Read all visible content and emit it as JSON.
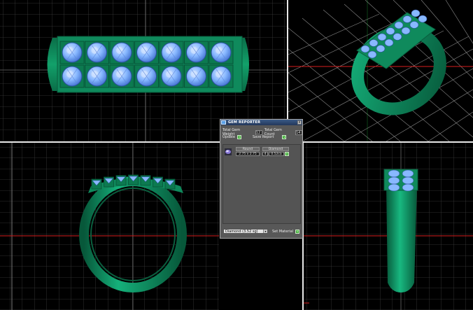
{
  "panel": {
    "title": "GEM REPORTER",
    "close_glyph": "x",
    "weight_label": "Total Gem Weight",
    "weight_value": "12",
    "count_label": "Total Gem Count",
    "count_value": "14",
    "update_label": "Update",
    "save_label": "Save Report",
    "green_glyph": "v",
    "gem": {
      "shape": "Round",
      "size": "2.75 x 2.75",
      "material": "Diamond",
      "count": "4",
      "weight": "0.52ca"
    },
    "material_select": "Diamond (3.52 sg)",
    "select_arrow": "▾",
    "set_material_label": "Set Material"
  },
  "colors": {
    "viewport_bg": "#000000",
    "grid": "#3a3a3a",
    "metal": "#0f8a5c",
    "metal_dark": "#0a5e3e",
    "gem": "#88b8ff",
    "gem_dark": "#4f7fd8",
    "axis_red": "#d81e1e",
    "axis_green": "#2bd64a"
  },
  "icons": [
    "gem-reporter-icon",
    "close-icon",
    "diamond-gem-icon",
    "dropdown-arrow-icon"
  ]
}
